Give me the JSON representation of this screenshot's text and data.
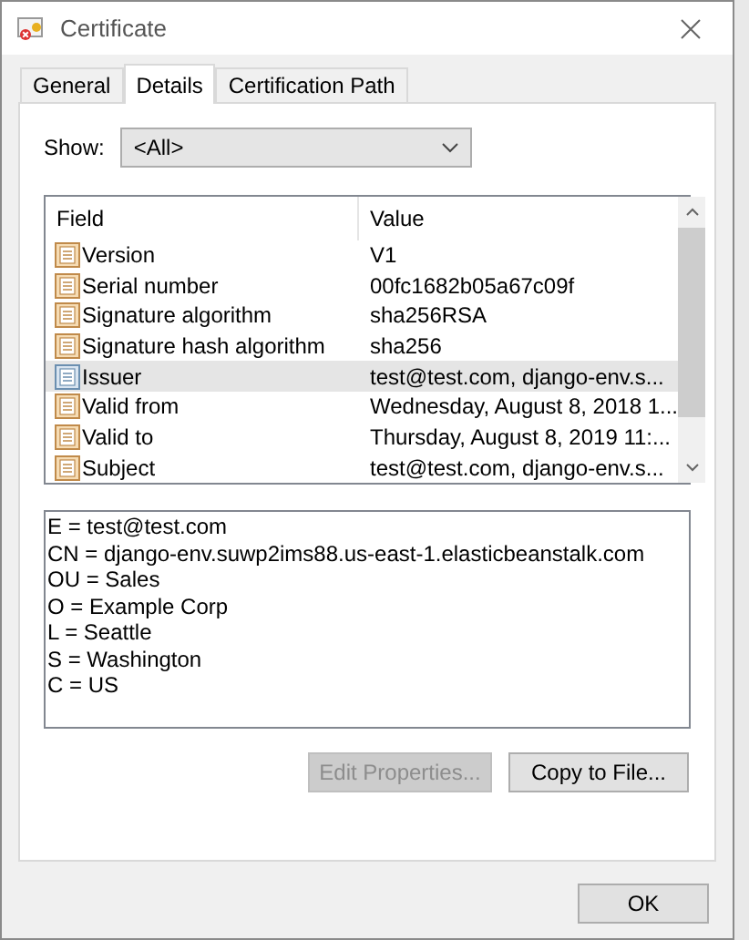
{
  "window": {
    "title": "Certificate"
  },
  "tabs": [
    {
      "label": "General",
      "selected": false
    },
    {
      "label": "Details",
      "selected": true
    },
    {
      "label": "Certification Path",
      "selected": false
    }
  ],
  "show": {
    "label": "Show:",
    "value": "<All>"
  },
  "table": {
    "columns": [
      "Field",
      "Value"
    ],
    "rows": [
      {
        "field": "Version",
        "value": "V1",
        "selected": false
      },
      {
        "field": "Serial number",
        "value": "00fc1682b05a67c09f",
        "selected": false
      },
      {
        "field": "Signature algorithm",
        "value": "sha256RSA",
        "selected": false
      },
      {
        "field": "Signature hash algorithm",
        "value": "sha256",
        "selected": false
      },
      {
        "field": "Issuer",
        "value": "test@test.com, django-env.s...",
        "selected": true
      },
      {
        "field": "Valid from",
        "value": "Wednesday, August 8, 2018 1...",
        "selected": false
      },
      {
        "field": "Valid to",
        "value": "Thursday, August 8, 2019 11:...",
        "selected": false
      },
      {
        "field": "Subject",
        "value": "test@test.com, django-env.s...",
        "selected": false
      }
    ]
  },
  "detail_lines": [
    "E = test@test.com",
    "CN = django-env.suwp2ims88.us-east-1.elasticbeanstalk.com",
    "OU = Sales",
    "O = Example Corp",
    "L = Seattle",
    "S = Washington",
    "C = US"
  ],
  "buttons": [
    {
      "label": "Edit Properties...",
      "disabled": true
    },
    {
      "label": "Copy to File...",
      "disabled": false
    }
  ],
  "ok_button": {
    "label": "OK"
  }
}
